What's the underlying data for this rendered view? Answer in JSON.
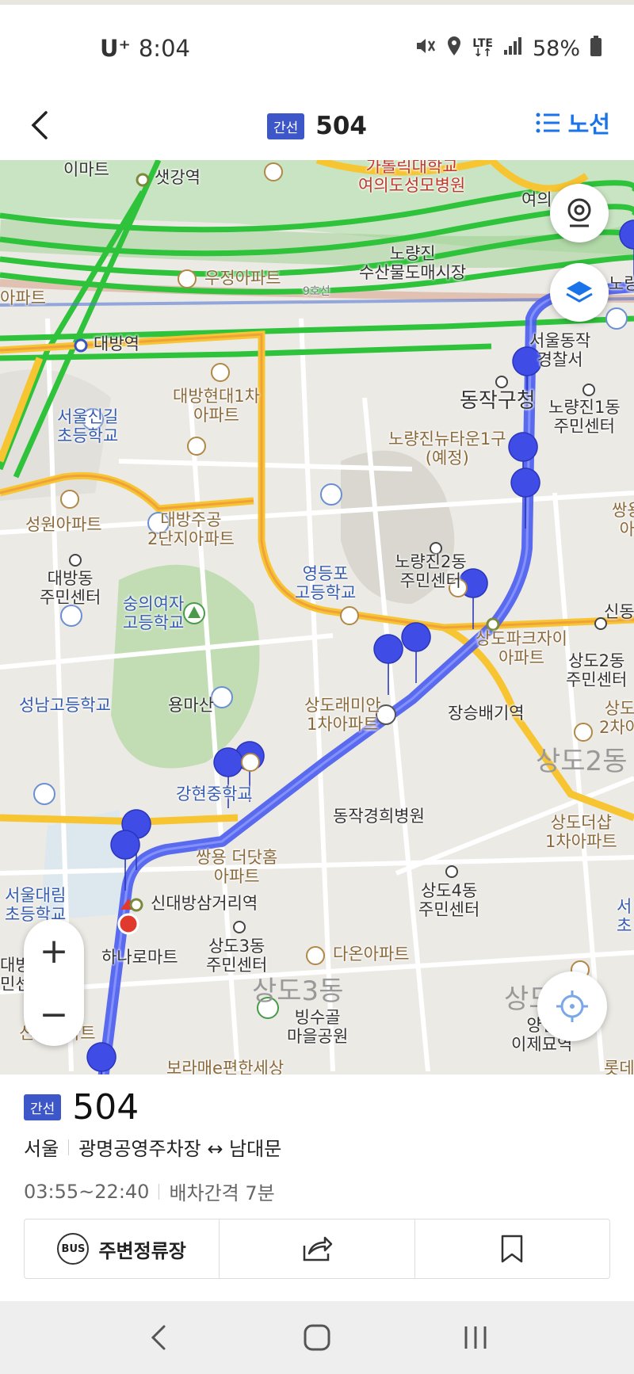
{
  "status_bar": {
    "carrier": "U⁺",
    "time": "8:04",
    "network": "LTE",
    "battery": "58%"
  },
  "header": {
    "badge": "간선",
    "title": "504",
    "route_label": "노선"
  },
  "map": {
    "labels": [
      {
        "text": "이마트",
        "cls": ""
      },
      {
        "text": "샛강역",
        "cls": ""
      },
      {
        "text": "가톨릭대학교\n여의도성모병원",
        "cls": "red"
      },
      {
        "text": "여의",
        "cls": ""
      },
      {
        "text": "노량진\n수산물도매시장",
        "cls": ""
      },
      {
        "text": "우정아파트",
        "cls": "brown"
      },
      {
        "text": "아파트",
        "cls": "brown"
      },
      {
        "text": "대방역",
        "cls": ""
      },
      {
        "text": "노량",
        "cls": ""
      },
      {
        "text": "서울동작\n경찰서",
        "cls": ""
      },
      {
        "text": "대방현대1차\n아파트",
        "cls": "brown"
      },
      {
        "text": "동작구청",
        "cls": ""
      },
      {
        "text": "노량진1동\n주민센터",
        "cls": ""
      },
      {
        "text": "서울신길\n초등학교",
        "cls": "blue"
      },
      {
        "text": "노량진뉴타운1구\n(예정)",
        "cls": "brown"
      },
      {
        "text": "쌍용\n아",
        "cls": "brown"
      },
      {
        "text": "성원아파트",
        "cls": "brown"
      },
      {
        "text": "대방주공\n2단지아파트",
        "cls": "brown"
      },
      {
        "text": "노량진2동\n주민센터",
        "cls": ""
      },
      {
        "text": "대방동\n주민센터",
        "cls": ""
      },
      {
        "text": "숭의여자\n고등학교",
        "cls": "blue"
      },
      {
        "text": "영등포\n고등학교",
        "cls": "blue"
      },
      {
        "text": "신동",
        "cls": ""
      },
      {
        "text": "상도파크자이\n아파트",
        "cls": "brown"
      },
      {
        "text": "상도2동\n주민센터",
        "cls": ""
      },
      {
        "text": "성남고등학교",
        "cls": "blue"
      },
      {
        "text": "용마산",
        "cls": ""
      },
      {
        "text": "상도래미안\n1차아파트",
        "cls": "brown"
      },
      {
        "text": "장승배기역",
        "cls": ""
      },
      {
        "text": "상도\n2차아",
        "cls": "brown"
      },
      {
        "text": "상도2동",
        "cls": "gray"
      },
      {
        "text": "강현중학교",
        "cls": "blue"
      },
      {
        "text": "동작경희병원",
        "cls": ""
      },
      {
        "text": "상도더샵\n1차아파트",
        "cls": "brown"
      },
      {
        "text": "쌍용 더닷홈\n아파트",
        "cls": "brown"
      },
      {
        "text": "상도4동\n주민센터",
        "cls": ""
      },
      {
        "text": "서울대림\n초등학교",
        "cls": "blue"
      },
      {
        "text": "신대방삼거리역",
        "cls": ""
      },
      {
        "text": "서\n초",
        "cls": "blue"
      },
      {
        "text": "상도3동\n주민센터",
        "cls": ""
      },
      {
        "text": "다온아파트",
        "cls": "brown"
      },
      {
        "text": "하나로마트",
        "cls": ""
      },
      {
        "text": "대방\n민센",
        "cls": ""
      },
      {
        "text": "상도3동",
        "cls": "gray"
      },
      {
        "text": "상도",
        "cls": "gray"
      },
      {
        "text": "빙수골\n마을공원",
        "cls": ""
      },
      {
        "text": "양년\n이제묘역",
        "cls": ""
      },
      {
        "text": "신동아파트",
        "cls": "brown"
      },
      {
        "text": "보라매e편한세상",
        "cls": "brown"
      },
      {
        "text": "롯데",
        "cls": "brown"
      },
      {
        "text": "9호선",
        "cls": ""
      }
    ],
    "zoom_in": "+",
    "zoom_out": "−"
  },
  "panel": {
    "badge": "간선",
    "number": "504",
    "region": "서울",
    "route": "광명공영주차장 ↔ 남대문",
    "hours": "03:55~22:40",
    "interval": "배차간격 7분",
    "bus_icon_text": "BUS",
    "nearby_label": "주변정류장"
  },
  "colors": {
    "accent": "#1a73e8",
    "badge": "#3d57c9",
    "bus_route": "#4a5cf0",
    "road_yellow": "#f7c531",
    "road_green": "#2fc23b"
  }
}
